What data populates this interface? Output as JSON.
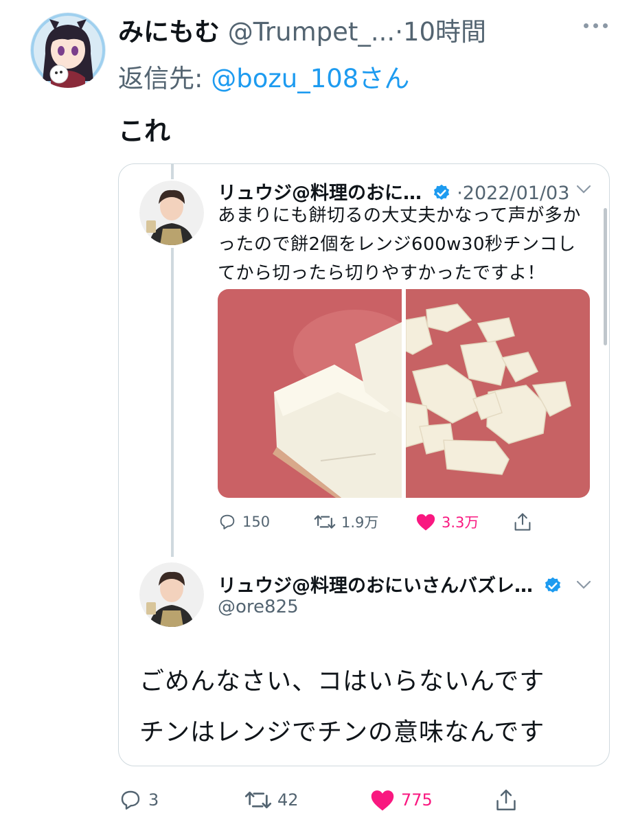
{
  "tweet": {
    "display_name": "みにもむ",
    "handle": "@Trumpet_...",
    "separator": "·",
    "time": "10時間",
    "reply_prefix": "返信先: ",
    "reply_to": "@bozu_108さん",
    "text": "これ",
    "actions": {
      "replies": "3",
      "retweets": "42",
      "likes": "775"
    }
  },
  "quote": {
    "display_name": "リュウジ@料理のおに…",
    "separator": "·",
    "date": "2022/01/03",
    "text": "あまりにも餅切るの大丈夫かなって声が多かったので餅2個をレンジ600w30秒チンコしてから切ったら切りやすかったですよ！",
    "actions": {
      "replies": "150",
      "retweets": "1.9万",
      "likes": "3.3万"
    }
  },
  "quote_reply": {
    "display_name": "リュウジ@料理のおにいさんバズレ…",
    "handle": "@ore825",
    "line1": "ごめんなさい、コはいらないんです",
    "line2": "チンはレンジでチンの意味なんです"
  },
  "colors": {
    "accent": "#1d9bf0",
    "like": "#f91880",
    "muted": "#536471",
    "border": "#cfd9de"
  },
  "icons": [
    "more-icon",
    "verified-icon",
    "chevron-down-icon",
    "reply-icon",
    "retweet-icon",
    "like-icon",
    "share-icon"
  ]
}
